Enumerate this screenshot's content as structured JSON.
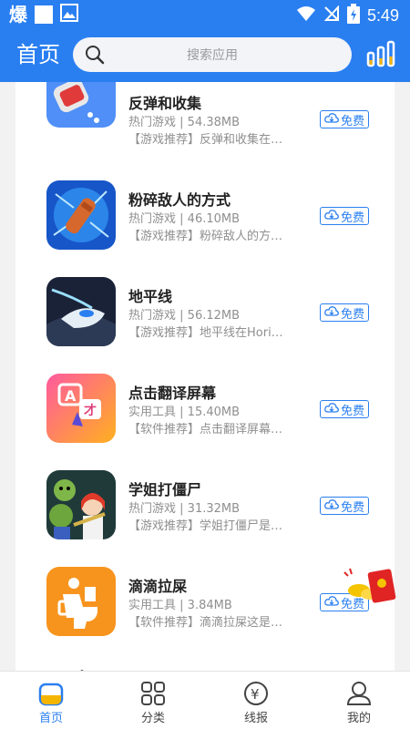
{
  "status_bar": {
    "left_glyph": "爆",
    "time": "5:49",
    "icons": [
      "wifi-icon",
      "no-sim-icon",
      "battery-icon"
    ]
  },
  "header": {
    "title": "首页",
    "search_placeholder": "搜索应用",
    "right_icon": "rank-chart-icon"
  },
  "apps": [
    {
      "name": "反弹和收集",
      "category": "热门游戏",
      "size": "54.38MB",
      "desc": "【游戏推荐】反弹和收集在…",
      "action": "免费",
      "icon": "red-cup-ball-icon"
    },
    {
      "name": "粉碎敌人的方式",
      "category": "热门游戏",
      "size": "46.10MB",
      "desc": "【游戏推荐】粉碎敌人的方…",
      "action": "免费",
      "icon": "crush-hammer-icon"
    },
    {
      "name": "地平线",
      "category": "热门游戏",
      "size": "56.12MB",
      "desc": "【游戏推荐】地平线在Hori…",
      "action": "免费",
      "icon": "spaceship-icon"
    },
    {
      "name": "点击翻译屏幕",
      "category": "实用工具",
      "size": "15.40MB",
      "desc": "【软件推荐】点击翻译屏幕…",
      "action": "免费",
      "icon": "translate-icon"
    },
    {
      "name": "学姐打僵尸",
      "category": "热门游戏",
      "size": "31.32MB",
      "desc": "【游戏推荐】学姐打僵尸是…",
      "action": "免费",
      "icon": "zombie-icon"
    },
    {
      "name": "滴滴拉屎",
      "category": "实用工具",
      "size": "3.84MB",
      "desc": "【软件推荐】滴滴拉屎这是…",
      "action": "免费",
      "icon": "toilet-icon"
    }
  ],
  "bottom_nav": [
    {
      "label": "首页",
      "icon": "home-icon",
      "active": true
    },
    {
      "label": "分类",
      "icon": "category-grid-icon",
      "active": false
    },
    {
      "label": "线报",
      "icon": "yuan-coin-icon",
      "active": false
    },
    {
      "label": "我的",
      "icon": "profile-icon",
      "active": false
    }
  ],
  "colors": {
    "primary": "#2a7ff0",
    "background": "#f2f2f2",
    "text_primary": "#222222",
    "text_secondary": "#8f8f8f"
  }
}
